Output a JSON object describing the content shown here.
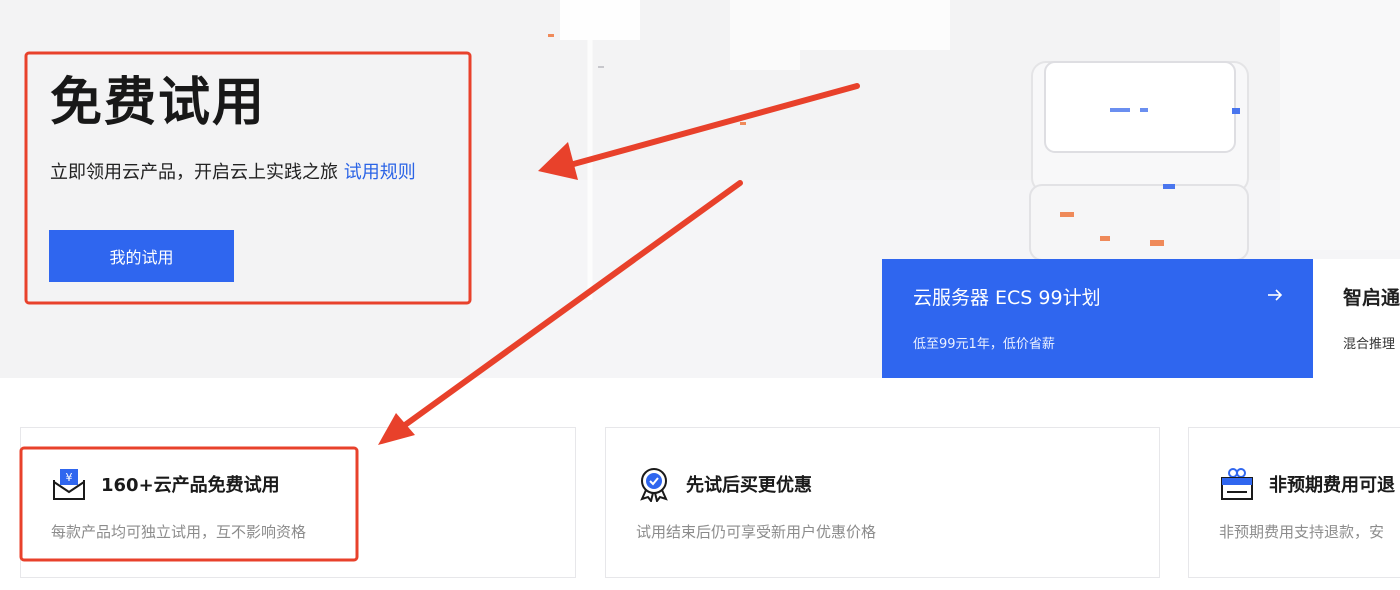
{
  "hero": {
    "title": "免费试用",
    "subtitle": "立即领用云产品，开启云上实践之旅",
    "rules_link": "试用规则",
    "cta_label": "我的试用"
  },
  "promos": [
    {
      "title": "云服务器 ECS 99计划",
      "subtitle": "低至99元1年，低价省薪",
      "arrow_icon": "arrow-right-icon"
    },
    {
      "title": "智启通",
      "subtitle": "混合推理"
    }
  ],
  "features": [
    {
      "icon": "envelope-yen-icon",
      "title": "160+云产品免费试用",
      "desc": "每款产品均可独立试用，互不影响资格"
    },
    {
      "icon": "badge-check-icon",
      "title": "先试后买更优惠",
      "desc": "试用结束后仍可享受新用户优惠价格"
    },
    {
      "icon": "gift-box-icon",
      "title": "非预期费用可退",
      "desc": "非预期费用支持退款，安"
    }
  ],
  "colors": {
    "brand_blue": "#2f66ef",
    "link_blue": "#2b64e6",
    "annotation_red": "#e8412b"
  }
}
